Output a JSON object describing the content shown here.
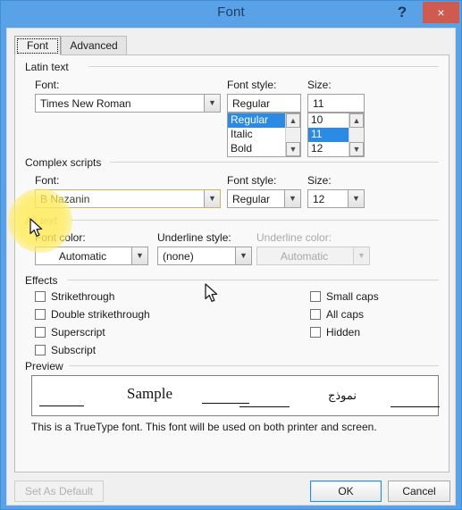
{
  "window": {
    "title": "Font",
    "help_label": "?",
    "close_label": "×"
  },
  "tabs": [
    {
      "label": "Font",
      "active": true
    },
    {
      "label": "Advanced",
      "active": false
    }
  ],
  "latin_text": {
    "group_label": "Latin text",
    "font": {
      "label": "Font:",
      "label_pre": "F",
      "label_accel": "o",
      "label_post": "nt:",
      "value": "Times New Roman"
    },
    "font_style": {
      "label": "Font style:",
      "value": "Regular",
      "options": [
        "Regular",
        "Italic",
        "Bold"
      ],
      "selected": "Regular"
    },
    "size": {
      "label": "Size:",
      "label_accel": "S",
      "label_post": "ize:",
      "value": "11",
      "options": [
        "10",
        "11",
        "12"
      ],
      "selected": "11"
    }
  },
  "complex_scripts": {
    "group_label": "Complex scripts",
    "font": {
      "label": "Font:",
      "value": "B Nazanin",
      "highlighted": true
    },
    "font_style": {
      "label": "Font style:",
      "value": "Regular"
    },
    "size": {
      "label": "Size:",
      "value": "12"
    }
  },
  "all_text": {
    "group_label": "All text",
    "font_color": {
      "label": "Font color:",
      "value": "Automatic"
    },
    "underline_style": {
      "label": "Underline style:",
      "value": "(none)"
    },
    "underline_color": {
      "label": "Underline color:",
      "value": "Automatic",
      "disabled": true
    }
  },
  "effects": {
    "group_label": "Effects",
    "left_column": [
      {
        "label": "Strikethrough",
        "checked": false
      },
      {
        "label": "Double strikethrough",
        "checked": false
      },
      {
        "label": "Superscript",
        "checked": false
      },
      {
        "label": "Subscript",
        "checked": false
      }
    ],
    "right_column": [
      {
        "label": "Small caps",
        "checked": false
      },
      {
        "label": "All caps",
        "checked": false
      },
      {
        "label": "Hidden",
        "checked": false
      }
    ]
  },
  "preview": {
    "group_label": "Preview",
    "sample_latin": "Sample",
    "sample_arabic": "نموذج",
    "note": "This is a TrueType font. This font will be used on both printer and screen."
  },
  "footer": {
    "set_as_default": "Set As Default",
    "ok": "OK",
    "cancel": "Cancel"
  },
  "colors": {
    "titlebar": "#5aa2e8",
    "close_button": "#cf5a50",
    "selection": "#2a8ae4",
    "spotlight": "#ffeb5a",
    "dialog_background": "#f0f0f0",
    "page_background": "#f9f9f9"
  }
}
